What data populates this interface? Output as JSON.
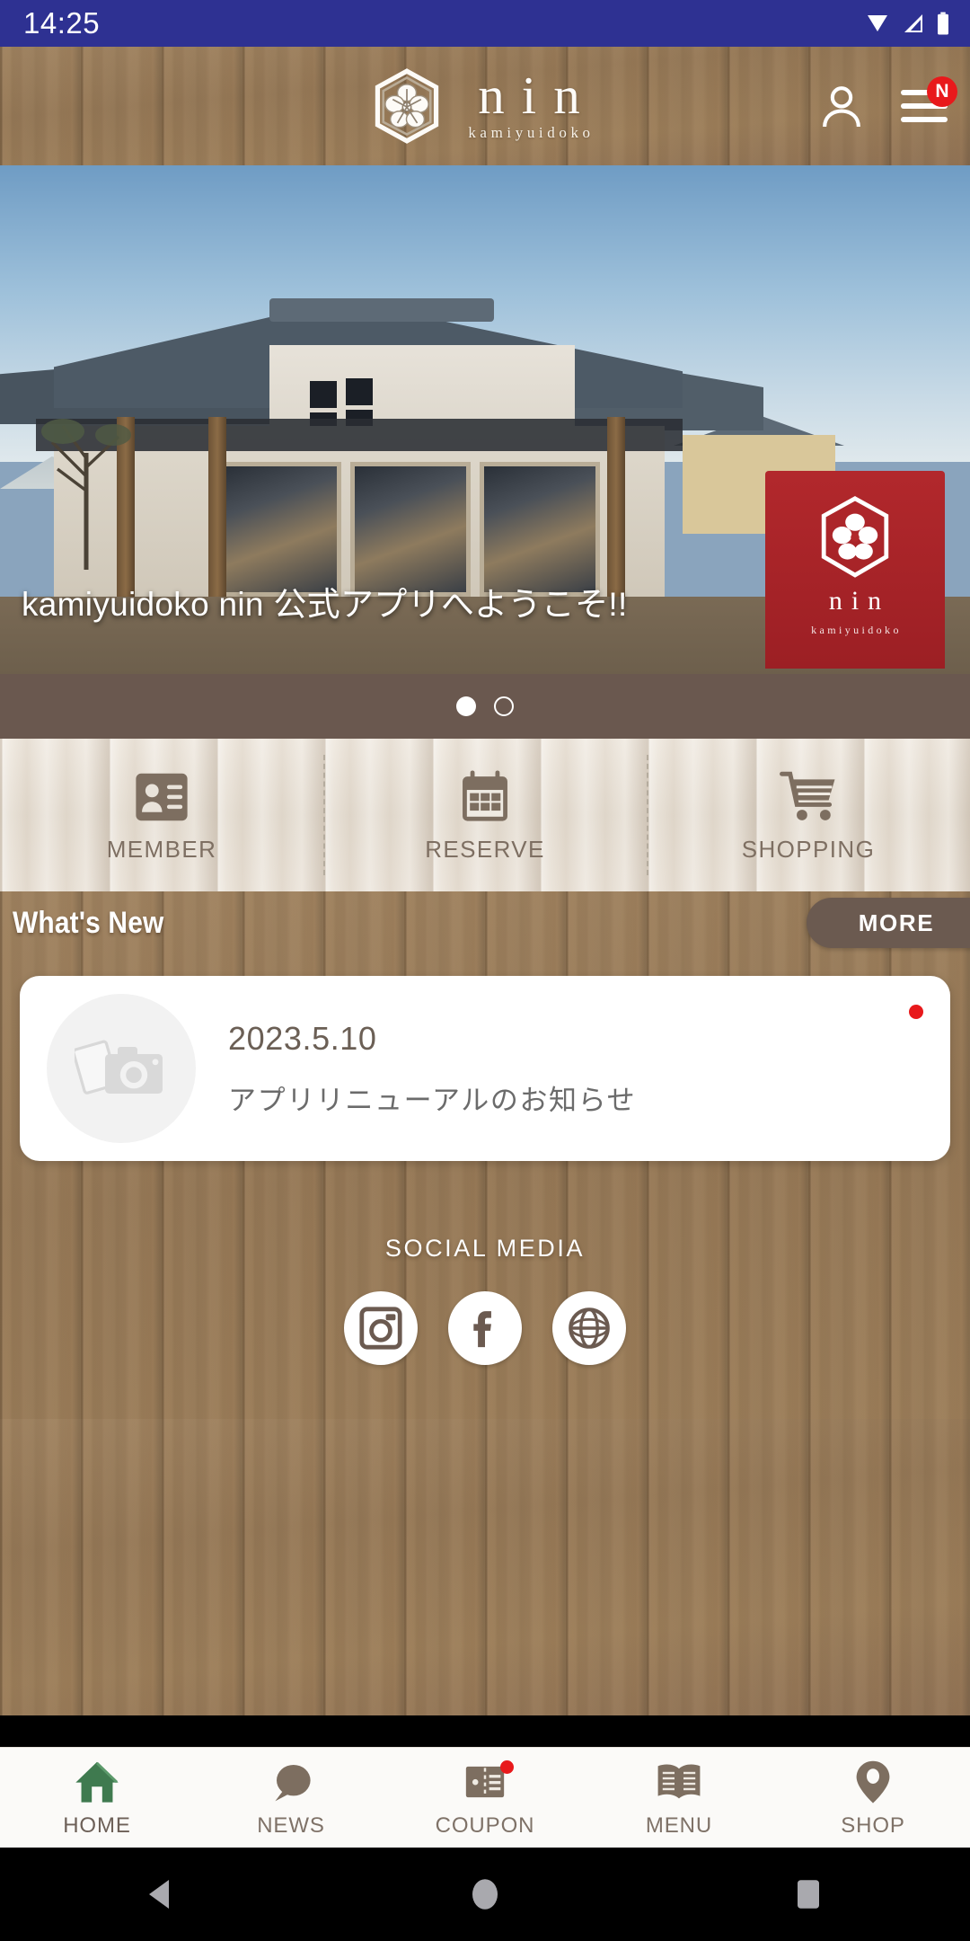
{
  "status_bar": {
    "time": "14:25",
    "icons": [
      "wifi-icon",
      "cellular-signal-icon",
      "battery-icon"
    ],
    "background_color": "#2e3192"
  },
  "app_header": {
    "logo_mark": "hexagon-flower-crest-icon",
    "brand_name": "nin",
    "brand_subtitle": "kamiyuidoko",
    "account_icon": "person-icon",
    "menu_icon": "hamburger-menu-icon",
    "menu_badge": "N",
    "badge_color": "#e8191b"
  },
  "hero": {
    "caption": "kamiyuidoko nin 公式アプリへようこそ!!",
    "curtain_brand": "nin",
    "curtain_sub": "kamiyuidoko",
    "slides_total": 2,
    "active_slide": 1,
    "dots_bar_color": "#6a584f"
  },
  "quick_actions": [
    {
      "label": "MEMBER",
      "icon": "id-card-icon"
    },
    {
      "label": "RESERVE",
      "icon": "calendar-icon"
    },
    {
      "label": "SHOPPING",
      "icon": "shopping-cart-icon"
    }
  ],
  "whats_new": {
    "section_title": "What's New",
    "more_label": "MORE",
    "more_button_color": "#6b5a50",
    "items": [
      {
        "date": "2023.5.10",
        "title": "アプリリニューアルのお知らせ",
        "thumbnail_icon": "photo-camera-placeholder-icon",
        "unread": true,
        "unread_color": "#e8191b"
      }
    ]
  },
  "social_media": {
    "title": "SOCIAL MEDIA",
    "links": [
      {
        "name": "instagram",
        "icon": "instagram-icon"
      },
      {
        "name": "facebook",
        "icon": "facebook-icon"
      },
      {
        "name": "website",
        "icon": "globe-icon"
      }
    ]
  },
  "bottom_nav": {
    "items": [
      {
        "label": "HOME",
        "icon": "house-icon",
        "active": true,
        "badge": false,
        "accent": "#3f7a4f"
      },
      {
        "label": "NEWS",
        "icon": "speech-bubble-icon",
        "active": false,
        "badge": false,
        "accent": "#7f7268"
      },
      {
        "label": "COUPON",
        "icon": "ticket-icon",
        "active": false,
        "badge": true,
        "accent": "#7f7268"
      },
      {
        "label": "MENU",
        "icon": "open-book-icon",
        "active": false,
        "badge": false,
        "accent": "#7f7268"
      },
      {
        "label": "SHOP",
        "icon": "map-pin-icon",
        "active": false,
        "badge": false,
        "accent": "#7f7268"
      }
    ]
  },
  "system_nav": {
    "back": "back-triangle-icon",
    "home": "home-circle-icon",
    "recents": "recents-square-icon"
  }
}
